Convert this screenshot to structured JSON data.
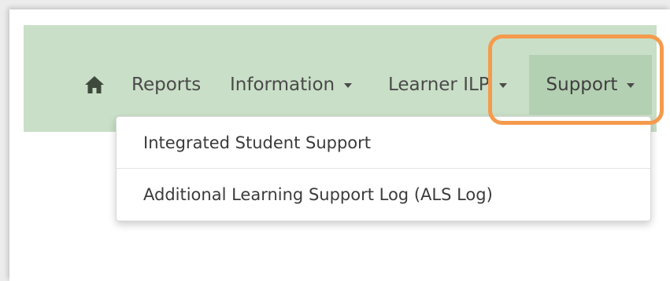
{
  "navbar": {
    "home_icon": "home-icon",
    "items": [
      {
        "label": "Reports",
        "has_caret": false
      },
      {
        "label": "Information",
        "has_caret": true
      },
      {
        "label": "Learner ILP",
        "has_caret": true
      },
      {
        "label": "Support",
        "has_caret": true,
        "active": true
      }
    ],
    "bg_color": "#c9dfc7",
    "active_bg_color": "#b4d0b2"
  },
  "dropdown": {
    "items": [
      {
        "label": "Integrated Student Support"
      },
      {
        "label": "Additional Learning Support Log (ALS Log)"
      }
    ]
  },
  "annotation": {
    "highlight_color": "#f59a4c"
  }
}
